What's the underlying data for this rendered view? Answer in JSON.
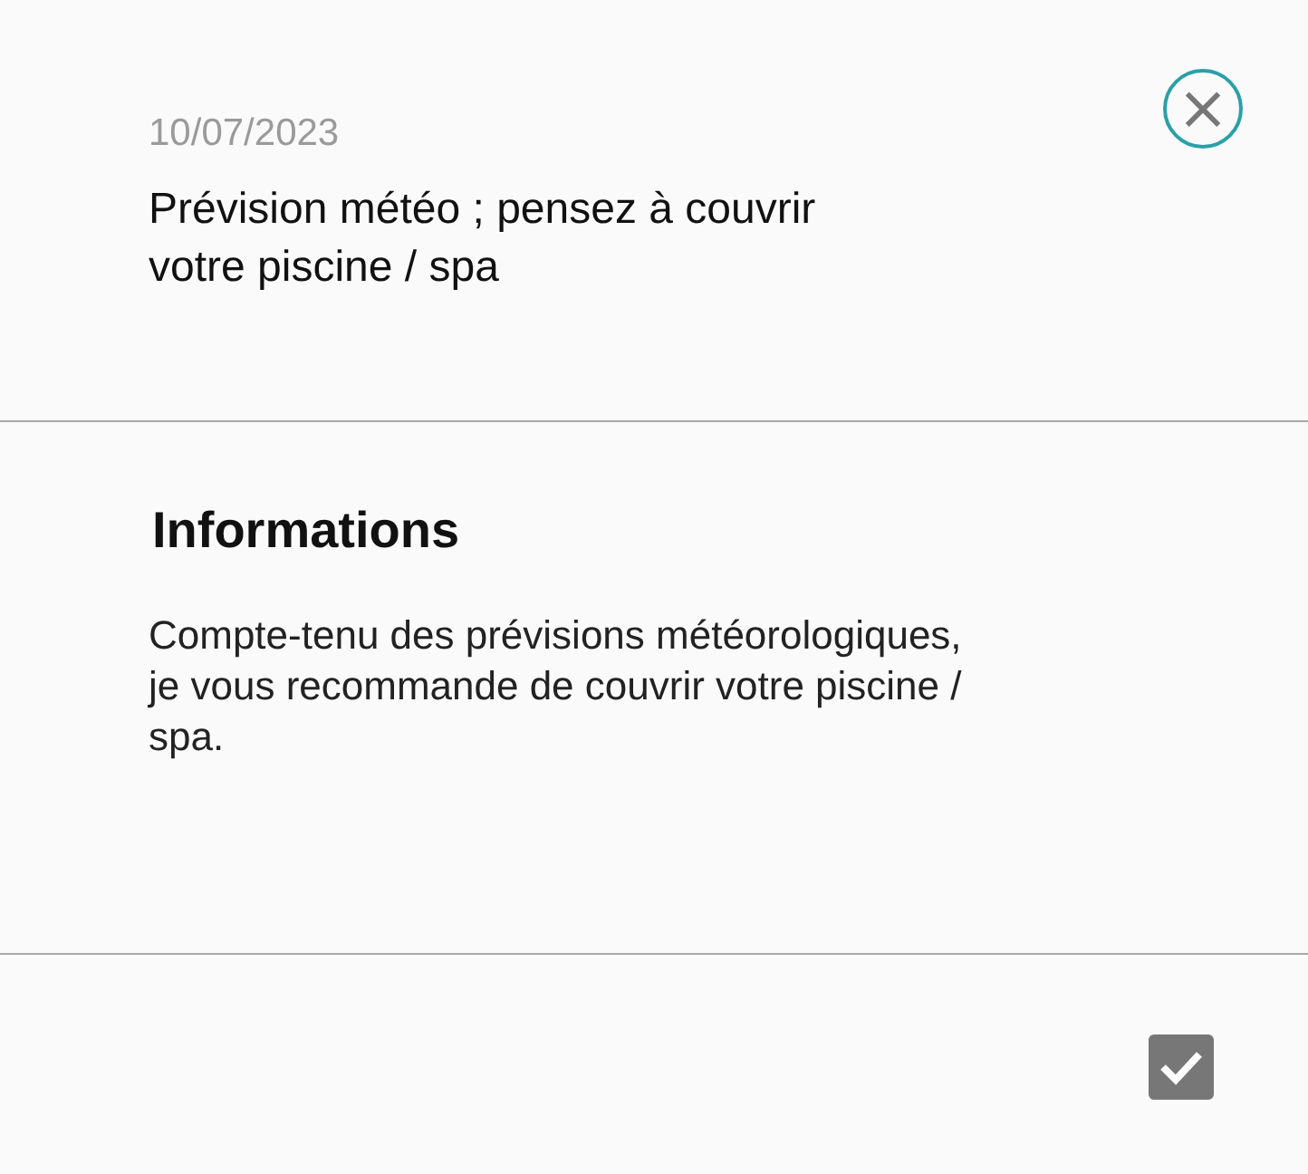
{
  "notification": {
    "date": "10/07/2023",
    "title": "Prévision météo ; pensez à couvrir votre piscine / spa"
  },
  "close_button": {
    "label": "×"
  },
  "details": {
    "heading": "Informations",
    "body": "Compte-tenu des prévisions météorologiques, je vous recommande de couvrir votre piscine / spa."
  },
  "acknowledge": {
    "checked": true
  }
}
